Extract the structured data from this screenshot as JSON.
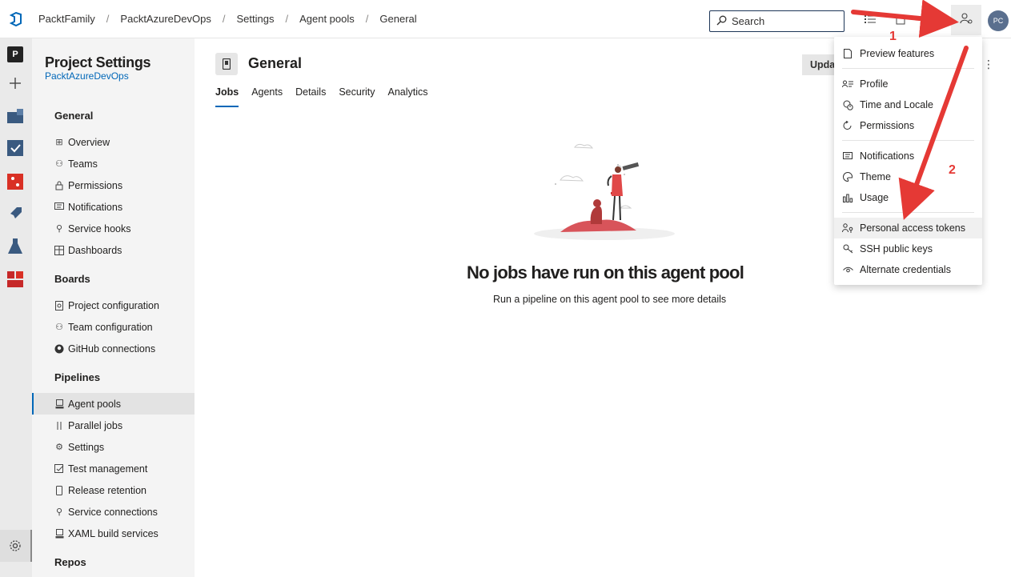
{
  "breadcrumb": [
    "PacktFamily",
    "PacktAzureDevOps",
    "Settings",
    "Agent pools",
    "General"
  ],
  "search": {
    "placeholder": "Search"
  },
  "avatar": {
    "initials": "PC"
  },
  "rail": {
    "project_initial": "P"
  },
  "sidebar": {
    "title": "Project Settings",
    "subtitle": "PacktAzureDevOps",
    "sections": [
      {
        "heading": "General",
        "items": [
          "Overview",
          "Teams",
          "Permissions",
          "Notifications",
          "Service hooks",
          "Dashboards"
        ]
      },
      {
        "heading": "Boards",
        "items": [
          "Project configuration",
          "Team configuration",
          "GitHub connections"
        ]
      },
      {
        "heading": "Pipelines",
        "items": [
          "Agent pools",
          "Parallel jobs",
          "Settings",
          "Test management",
          "Release retention",
          "Service connections",
          "XAML build services"
        ]
      },
      {
        "heading": "Repos",
        "items": []
      }
    ],
    "selected": "Agent pools"
  },
  "main": {
    "title": "General",
    "tabs": [
      "Jobs",
      "Agents",
      "Details",
      "Security",
      "Analytics"
    ],
    "active_tab": "Jobs",
    "update_button": "Update",
    "empty_title": "No jobs have run on this agent pool",
    "empty_subtitle": "Run a pipeline on this agent pool to see more details"
  },
  "user_menu": {
    "items": [
      {
        "label": "Preview features",
        "icon": "page-icon"
      },
      {
        "label": "Profile",
        "icon": "profile-icon"
      },
      {
        "label": "Time and Locale",
        "icon": "globe-icon"
      },
      {
        "label": "Permissions",
        "icon": "refresh-icon"
      },
      {
        "label": "Notifications",
        "icon": "chat-icon"
      },
      {
        "label": "Theme",
        "icon": "palette-icon"
      },
      {
        "label": "Usage",
        "icon": "bar-chart-icon"
      },
      {
        "label": "Personal access tokens",
        "icon": "key-person-icon"
      },
      {
        "label": "SSH public keys",
        "icon": "key-icon"
      },
      {
        "label": "Alternate credentials",
        "icon": "eye-icon"
      }
    ],
    "highlighted": "Personal access tokens"
  },
  "annotations": {
    "step1": "1",
    "step2": "2",
    "color": "#e53935"
  }
}
